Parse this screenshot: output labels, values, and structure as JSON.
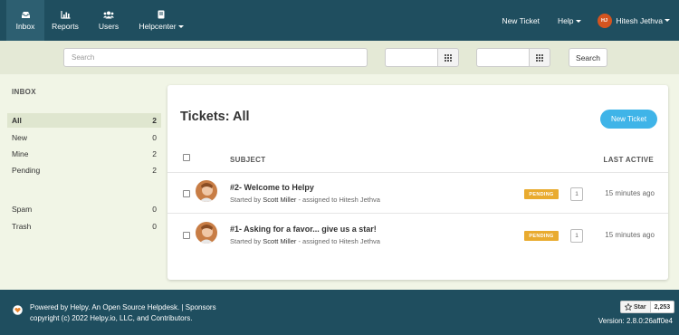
{
  "nav": {
    "items": [
      {
        "label": "Inbox",
        "icon": "inbox-icon",
        "active": true
      },
      {
        "label": "Reports",
        "icon": "bar-chart-icon",
        "active": false
      },
      {
        "label": "Users",
        "icon": "users-icon",
        "active": false
      }
    ],
    "helpcenter": {
      "label": "Helpcenter",
      "icon": "book-icon"
    },
    "new_ticket": "New Ticket",
    "help": "Help",
    "user": {
      "initials": "HJ",
      "name": "Hitesh Jethva"
    }
  },
  "search": {
    "placeholder": "Search",
    "button": "Search"
  },
  "sidebar": {
    "title": "INBOX",
    "items": [
      {
        "label": "All",
        "count": "2",
        "active": true
      },
      {
        "label": "New",
        "count": "0"
      },
      {
        "label": "Mine",
        "count": "2"
      },
      {
        "label": "Pending",
        "count": "2"
      },
      {
        "label": "Spam",
        "count": "0"
      },
      {
        "label": "Trash",
        "count": "0"
      }
    ]
  },
  "tickets": {
    "title": "Tickets: All",
    "new_button": "New Ticket",
    "columns": {
      "subject": "SUBJECT",
      "last_active": "LAST ACTIVE"
    },
    "rows": [
      {
        "subject": "#2- Welcome to Helpy",
        "started_prefix": "Started by",
        "started_by": "Scott Miller",
        "assigned_prefix": "- assigned to",
        "assigned_to": "Hitesh Jethva",
        "status": "PENDING",
        "count": "1",
        "time": "15 minutes ago"
      },
      {
        "subject": "#1- Asking for a favor... give us a star!",
        "started_prefix": "Started by",
        "started_by": "Scott Miller",
        "assigned_prefix": "- assigned to",
        "assigned_to": "Hitesh Jethva",
        "status": "PENDING",
        "count": "1",
        "time": "15 minutes ago"
      }
    ]
  },
  "footer": {
    "line1": "Powered by Helpy. An Open Source Helpdesk. | Sponsors",
    "line2": "copyright (c) 2022 Helpy.io, LLC, and Contributors.",
    "star_label": "Star",
    "star_count": "2,253",
    "version": "Version: 2.8.0:26aff0e4"
  },
  "colors": {
    "nav_bg": "#1f4e5f",
    "accent": "#3fb4e8",
    "pending": "#e9ab2f",
    "page_bg": "#f1f5e6"
  }
}
